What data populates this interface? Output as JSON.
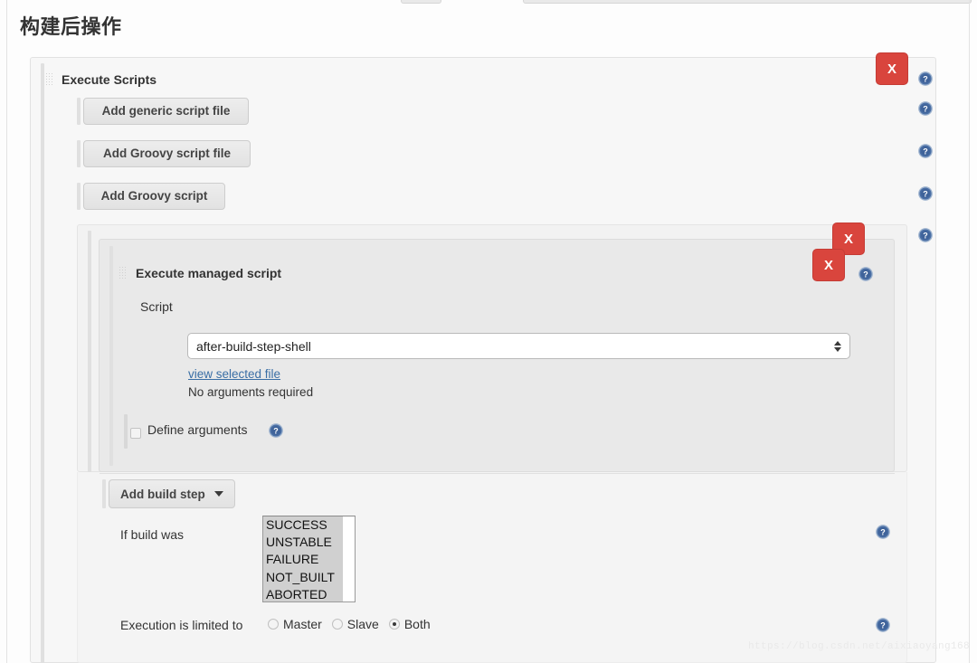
{
  "page": {
    "title": "构建后操作",
    "watermark": "https://blog.csdn.net/aixiaoyang168"
  },
  "colors": {
    "delete_button": "#d9453d",
    "help_icon": "#4a6fa5",
    "link": "#3a6ea5",
    "panel_bg": "#f7f7f7",
    "inner_panel_bg": "#e9e9e9"
  },
  "execute_scripts": {
    "title": "Execute Scripts",
    "delete_label": "X",
    "buttons": [
      {
        "label": "Add generic script file"
      },
      {
        "label": "Add Groovy script file"
      },
      {
        "label": "Add Groovy script"
      }
    ]
  },
  "managed_script": {
    "title": "Execute managed script",
    "delete_label_outer": "X",
    "delete_label_inner": "X",
    "script_label": "Script",
    "script_select_value": "after-build-step-shell",
    "view_link": "view selected file",
    "arguments_note": "No arguments required",
    "define_arguments_label": "Define arguments",
    "define_arguments_checked": false
  },
  "build_step": {
    "add_label": "Add build step",
    "caret": "caret-down-icon"
  },
  "if_build_was": {
    "label": "If build was",
    "options": [
      "SUCCESS",
      "UNSTABLE",
      "FAILURE",
      "NOT_BUILT",
      "ABORTED"
    ],
    "selected": [
      "SUCCESS",
      "UNSTABLE",
      "FAILURE",
      "NOT_BUILT",
      "ABORTED"
    ]
  },
  "execution_limit": {
    "label": "Execution is limited to",
    "options": [
      {
        "label": "Master",
        "selected": false
      },
      {
        "label": "Slave",
        "selected": false
      },
      {
        "label": "Both",
        "selected": true
      }
    ]
  },
  "help_icons": {
    "name": "help-icon",
    "glyph": "?"
  }
}
